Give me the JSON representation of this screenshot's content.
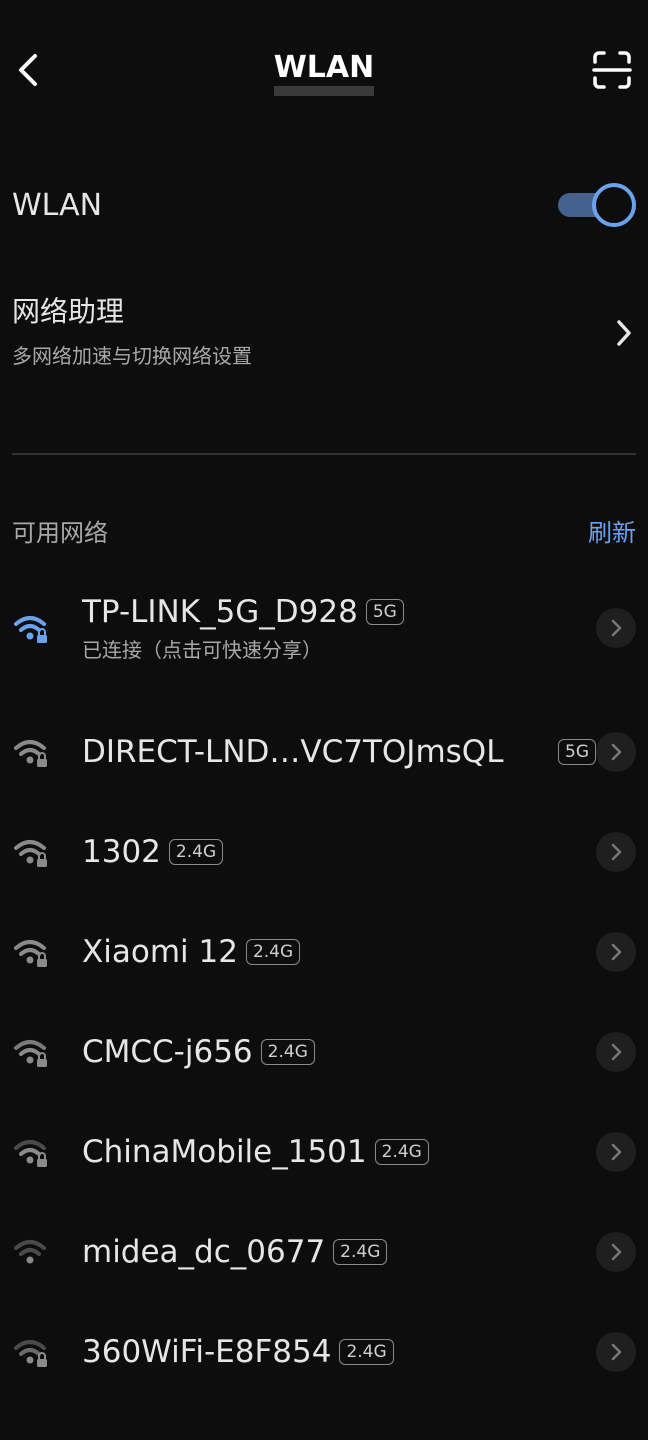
{
  "header": {
    "title": "WLAN"
  },
  "wlan": {
    "label": "WLAN",
    "enabled": true
  },
  "assistant": {
    "title": "网络助理",
    "subtitle": "多网络加速与切换网络设置"
  },
  "available": {
    "label": "可用网络",
    "refresh": "刷新"
  },
  "networks": [
    {
      "name": "TP-LINK_5G_D928",
      "band": "5G",
      "status": "已连接（点击可快速分享）"
    },
    {
      "name": "DIRECT-LND…VC7TOJmsQL",
      "band": "5G"
    },
    {
      "name": "1302",
      "band": "2.4G"
    },
    {
      "name": "Xiaomi 12",
      "band": "2.4G"
    },
    {
      "name": "CMCC-j656",
      "band": "2.4G"
    },
    {
      "name": "ChinaMobile_1501",
      "band": "2.4G"
    },
    {
      "name": "midea_dc_0677",
      "band": "2.4G"
    },
    {
      "name": "360WiFi-E8F854",
      "band": "2.4G"
    }
  ],
  "colors": {
    "accent": "#6aa2f0",
    "background": "#0d0d0d"
  }
}
